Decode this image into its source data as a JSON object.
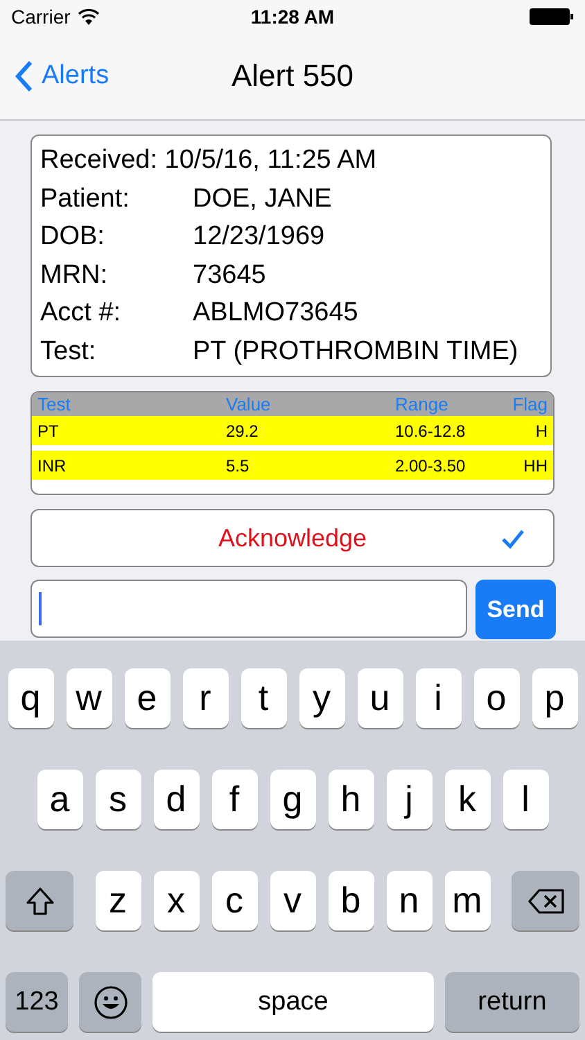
{
  "status_bar": {
    "carrier": "Carrier",
    "time": "11:28 AM"
  },
  "nav": {
    "back": "Alerts",
    "title": "Alert 550"
  },
  "details": [
    {
      "kind": "inline",
      "label": "Received:",
      "value": "10/5/16, 11:25 AM"
    },
    {
      "kind": "column",
      "label": "Patient:",
      "value": "DOE, JANE"
    },
    {
      "kind": "column",
      "label": "DOB:",
      "value": "12/23/1969"
    },
    {
      "kind": "column",
      "label": "MRN:",
      "value": "73645"
    },
    {
      "kind": "column",
      "label": "Acct #:",
      "value": "ABLMO73645"
    },
    {
      "kind": "column",
      "label": "Test:",
      "value": "PT (PROTHROMBIN TIME)"
    }
  ],
  "results": {
    "columns": [
      "Test",
      "Value",
      "Range",
      "Flag"
    ],
    "rows": [
      {
        "cells": [
          "PT",
          "29.2",
          "10.6-12.8",
          "H"
        ],
        "highlighted": true
      },
      {
        "cells": [
          "INR",
          "5.5",
          "2.00-3.50",
          "HH"
        ],
        "highlighted": true
      }
    ]
  },
  "acknowledge": {
    "label": "Acknowledge",
    "checked": true
  },
  "message": {
    "send": "Send"
  },
  "keyboard": {
    "rows": [
      [
        {
          "kind": "letter",
          "label": "q"
        },
        {
          "kind": "letter",
          "label": "w"
        },
        {
          "kind": "letter",
          "label": "e"
        },
        {
          "kind": "letter",
          "label": "r"
        },
        {
          "kind": "letter",
          "label": "t"
        },
        {
          "kind": "letter",
          "label": "y"
        },
        {
          "kind": "letter",
          "label": "u"
        },
        {
          "kind": "letter",
          "label": "i"
        },
        {
          "kind": "letter",
          "label": "o"
        },
        {
          "kind": "letter",
          "label": "p"
        }
      ],
      [
        {
          "kind": "letter",
          "label": "a"
        },
        {
          "kind": "letter",
          "label": "s"
        },
        {
          "kind": "letter",
          "label": "d"
        },
        {
          "kind": "letter",
          "label": "f"
        },
        {
          "kind": "letter",
          "label": "g"
        },
        {
          "kind": "letter",
          "label": "h"
        },
        {
          "kind": "letter",
          "label": "j"
        },
        {
          "kind": "letter",
          "label": "k"
        },
        {
          "kind": "letter",
          "label": "l"
        }
      ],
      [
        {
          "kind": "shift"
        },
        {
          "kind": "letter",
          "label": "z"
        },
        {
          "kind": "letter",
          "label": "x"
        },
        {
          "kind": "letter",
          "label": "c"
        },
        {
          "kind": "letter",
          "label": "v"
        },
        {
          "kind": "letter",
          "label": "b"
        },
        {
          "kind": "letter",
          "label": "n"
        },
        {
          "kind": "letter",
          "label": "m"
        },
        {
          "kind": "delete"
        }
      ]
    ],
    "bottom_row": [
      {
        "kind": "mode",
        "label": "123"
      },
      {
        "kind": "emoji"
      },
      {
        "kind": "space",
        "label": "space"
      },
      {
        "kind": "return",
        "label": "return"
      }
    ]
  }
}
